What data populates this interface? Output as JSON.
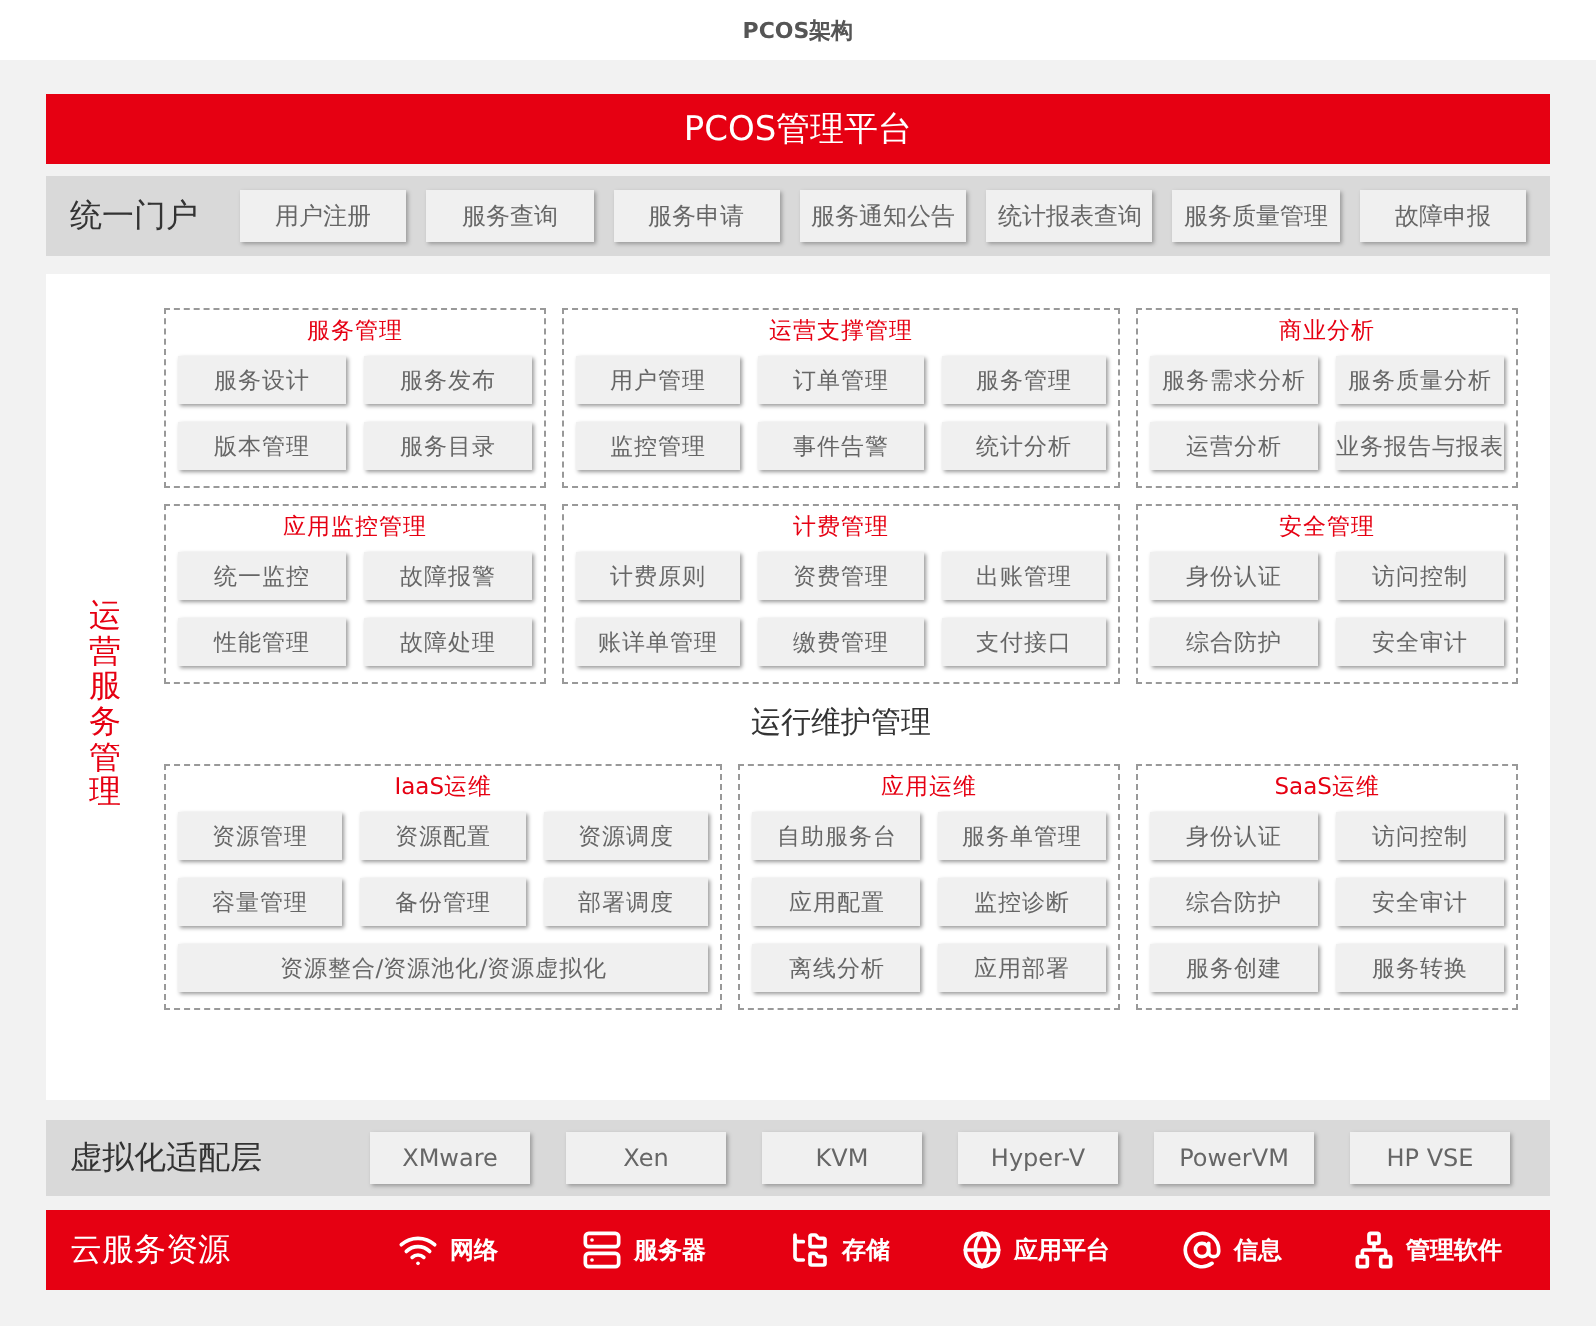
{
  "page_title": "PCOS架构",
  "platform_title": "PCOS管理平台",
  "portal": {
    "label": "统一门户",
    "items": [
      "用户注册",
      "服务查询",
      "服务申请",
      "服务通知公告",
      "统计报表查询",
      "服务质量管理",
      "故障申报"
    ]
  },
  "operations": {
    "label": "运营服务管理",
    "group_rows": [
      [
        {
          "title": "服务管理",
          "rows": [
            [
              "服务设计",
              "服务发布"
            ],
            [
              "版本管理",
              "服务目录"
            ]
          ]
        },
        {
          "title": "运营支撑管理",
          "rows": [
            [
              "用户管理",
              "订单管理",
              "服务管理"
            ],
            [
              "监控管理",
              "事件告警",
              "统计分析"
            ]
          ]
        },
        {
          "title": "商业分析",
          "rows": [
            [
              "服务需求分析",
              "服务质量分析"
            ],
            [
              "运营分析",
              "业务报告与报表"
            ]
          ]
        }
      ],
      [
        {
          "title": "应用监控管理",
          "rows": [
            [
              "统一监控",
              "故障报警"
            ],
            [
              "性能管理",
              "故障处理"
            ]
          ]
        },
        {
          "title": "计费管理",
          "rows": [
            [
              "计费原则",
              "资费管理",
              "出账管理"
            ],
            [
              "账详单管理",
              "缴费管理",
              "支付接口"
            ]
          ]
        },
        {
          "title": "安全管理",
          "rows": [
            [
              "身份认证",
              "访问控制"
            ],
            [
              "综合防护",
              "安全审计"
            ]
          ]
        }
      ]
    ]
  },
  "maintenance": {
    "title": "运行维护管理",
    "groups": [
      {
        "title": "IaaS运维",
        "rows": [
          [
            "资源管理",
            "资源配置",
            "资源调度"
          ],
          [
            "容量管理",
            "备份管理",
            "部署调度"
          ],
          [
            "资源整合/资源池化/资源虚拟化"
          ]
        ]
      },
      {
        "title": "应用运维",
        "rows": [
          [
            "自助服务台",
            "服务单管理"
          ],
          [
            "应用配置",
            "监控诊断"
          ],
          [
            "离线分析",
            "应用部署"
          ]
        ]
      },
      {
        "title": "SaaS运维",
        "rows": [
          [
            "身份认证",
            "访问控制"
          ],
          [
            "综合防护",
            "安全审计"
          ],
          [
            "服务创建",
            "服务转换"
          ]
        ]
      }
    ]
  },
  "virtualization": {
    "label": "虚拟化适配层",
    "items": [
      "XMware",
      "Xen",
      "KVM",
      "Hyper-V",
      "PowerVM",
      "HP VSE"
    ]
  },
  "cloud": {
    "label": "云服务资源",
    "items": [
      "网络",
      "服务器",
      "存储",
      "应用平台",
      "信息",
      "管理软件"
    ]
  }
}
